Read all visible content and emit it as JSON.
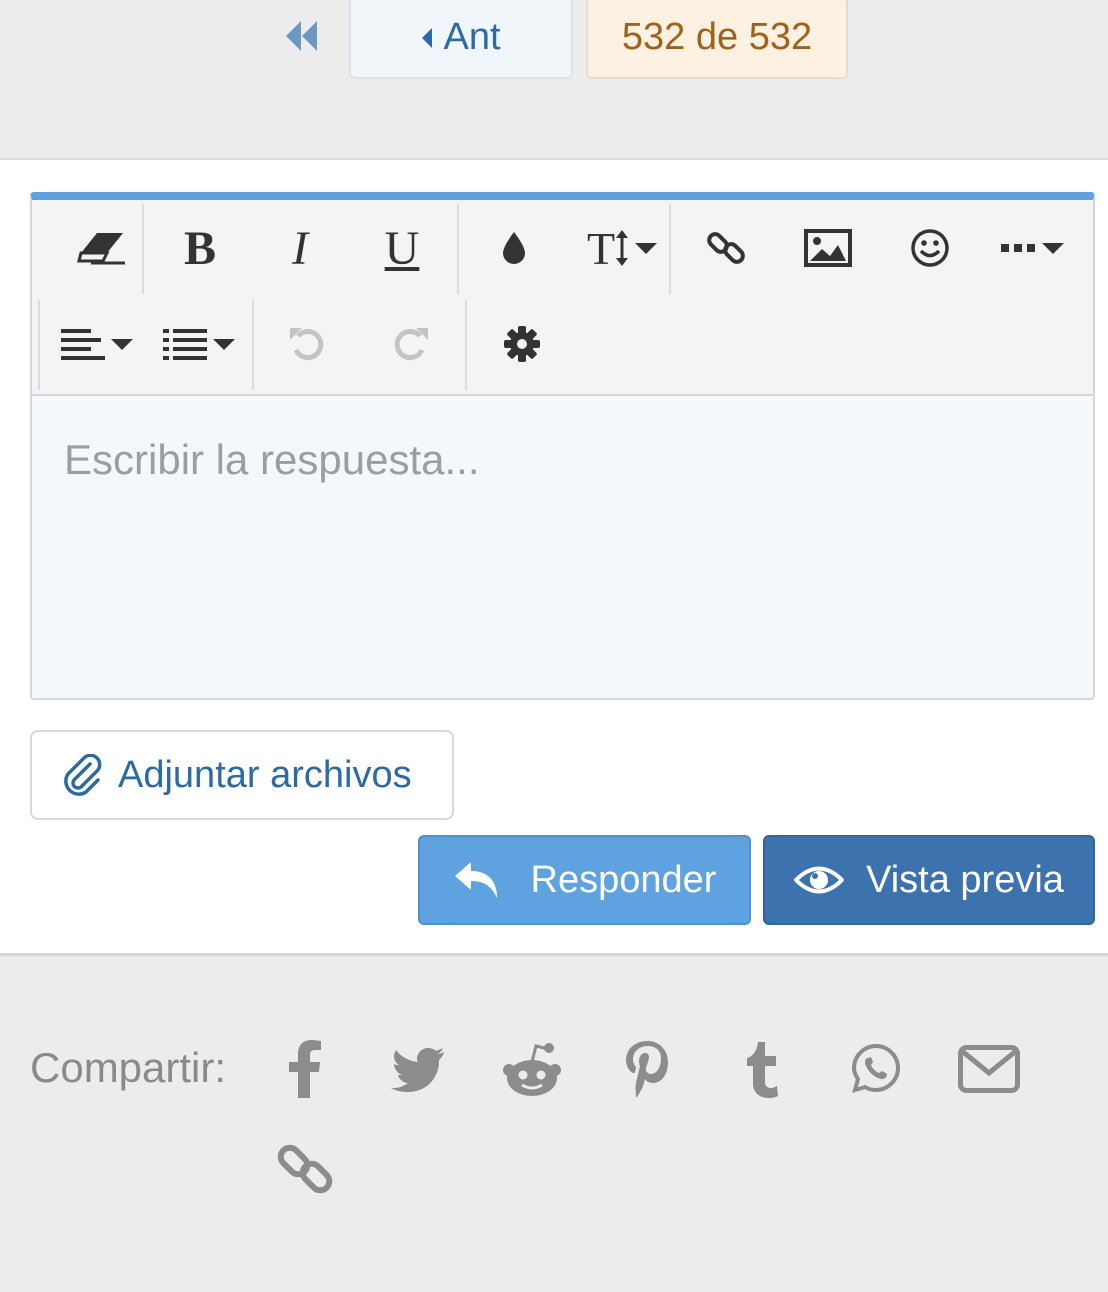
{
  "pagination": {
    "prev_label": "Ant",
    "current_label": "532 de 532"
  },
  "editor": {
    "placeholder": "Escribir la respuesta...",
    "toolbar": [
      {
        "name": "eraser-icon"
      },
      {
        "name": "bold",
        "label": "B"
      },
      {
        "name": "italic",
        "label": "I"
      },
      {
        "name": "underline",
        "label": "U"
      },
      {
        "name": "color-drop-icon"
      },
      {
        "name": "font-size-icon",
        "label": "T"
      },
      {
        "name": "link-icon"
      },
      {
        "name": "image-icon"
      },
      {
        "name": "smile-icon"
      },
      {
        "name": "more-icon"
      },
      {
        "name": "align-icon"
      },
      {
        "name": "list-icon"
      },
      {
        "name": "undo-icon"
      },
      {
        "name": "redo-icon"
      },
      {
        "name": "gear-icon"
      }
    ],
    "accent_color": "#5ea1de"
  },
  "actions": {
    "attach_label": "Adjuntar archivos",
    "reply_label": "Responder",
    "preview_label": "Vista previa"
  },
  "share": {
    "label": "Compartir:",
    "icons": [
      "facebook-icon",
      "twitter-icon",
      "reddit-icon",
      "pinterest-icon",
      "tumblr-icon",
      "whatsapp-icon",
      "email-icon",
      "link-icon"
    ]
  }
}
